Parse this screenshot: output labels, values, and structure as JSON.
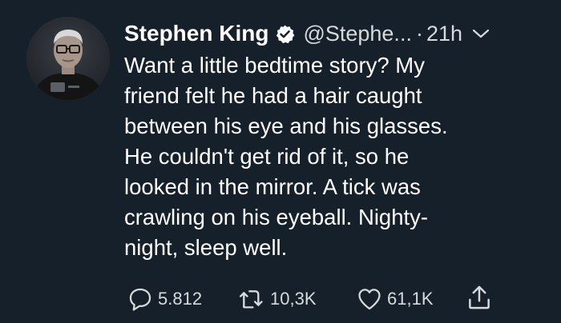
{
  "author": {
    "name": "Stephen King",
    "handle": "@Stephe...",
    "separator": "·",
    "time": "21h",
    "verified": true,
    "avatar_icon": "profile-photo"
  },
  "tweet": {
    "lines": [
      "Want a little bedtime story? My",
      "friend felt he had a hair caught",
      "between his eye and his glasses.",
      "He couldn't get rid of it, so he",
      "looked in the mirror. A tick was",
      "crawling on his eyeball. Nighty-",
      "night, sleep well."
    ]
  },
  "actions": {
    "reply": {
      "icon": "reply-icon",
      "count": "5.812"
    },
    "retweet": {
      "icon": "retweet-icon",
      "count": "10,3K"
    },
    "like": {
      "icon": "heart-icon",
      "count": "61,1K"
    },
    "share": {
      "icon": "share-icon"
    }
  },
  "colors": {
    "background": "#15202b",
    "text": "#ffffff",
    "secondary": "#d7dadd"
  }
}
